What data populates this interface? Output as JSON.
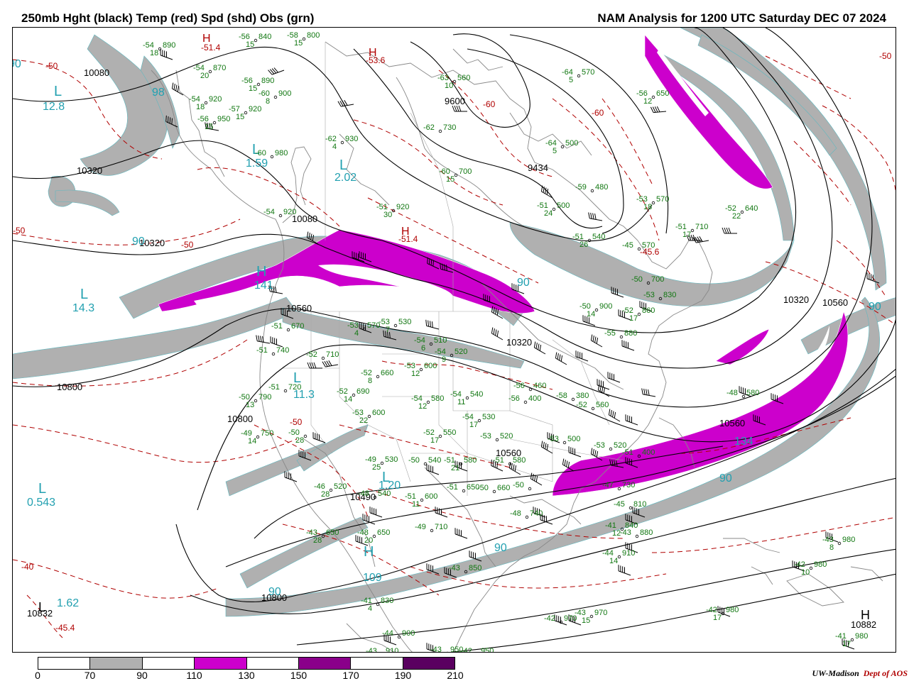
{
  "header": {
    "left_title": "250mb Hght (black) Temp (red) Spd (shd) Obs (grn)",
    "right_title": "NAM Analysis for 1200 UTC Saturday  DEC 07 2024"
  },
  "credit": {
    "org": "UW-Madison",
    "dept": "Dept of AOS"
  },
  "colors": {
    "height_contour": "#000000",
    "temp_contour": "#b00000",
    "obs": "#117711",
    "speed_label": "#22a0b0",
    "land": "#888888"
  },
  "colorbar": {
    "ticks": [
      "0",
      "70",
      "90",
      "110",
      "130",
      "150",
      "170",
      "190",
      "210"
    ],
    "segments": [
      "#ffffff",
      "#b0b0b0",
      "#ffffff",
      "#cc00cc",
      "#ffffff",
      "#8a008a",
      "#ffffff",
      "#5a0060"
    ]
  },
  "height_labels": [
    "10080",
    "10320",
    "10320",
    "10080",
    "10560",
    "10800",
    "10800",
    "10800",
    "10832",
    "10490",
    "10560",
    "10320",
    "10320",
    "10560",
    "10560",
    "10882",
    "9434",
    "9600"
  ],
  "temp_labels": [
    "-50",
    "-50",
    "-50",
    "-50",
    "-60",
    "-60",
    "-40",
    "-45.4",
    "-51.4",
    "-53.6",
    "-51.4",
    "-45.6",
    "-50"
  ],
  "pressure_centers": [
    {
      "letter": "H",
      "value": ""
    },
    {
      "letter": "H",
      "value": ""
    },
    {
      "letter": "H",
      "value": ""
    },
    {
      "letter": "L",
      "value": ""
    },
    {
      "letter": "L",
      "value": ""
    },
    {
      "letter": "L",
      "value": ""
    },
    {
      "letter": "L",
      "value": ""
    },
    {
      "letter": "L",
      "value": ""
    },
    {
      "letter": "L",
      "value": ""
    },
    {
      "letter": "H",
      "value": ""
    },
    {
      "letter": "L",
      "value": ""
    },
    {
      "letter": "L",
      "value": ""
    },
    {
      "letter": "H",
      "value": ""
    },
    {
      "letter": "H",
      "value": ""
    }
  ],
  "speed_labels": [
    "12.8",
    "141",
    "14.3",
    "1.59",
    "2.02",
    "0.543",
    "1.62",
    "1.20",
    "109",
    "11.3",
    "134",
    "98",
    "90",
    "90",
    "90",
    "90",
    "90",
    "90",
    "90",
    "90"
  ],
  "observations": [
    {
      "t": "-54",
      "h": "890",
      "d": "18"
    },
    {
      "t": "-54",
      "h": "870",
      "d": "20"
    },
    {
      "t": "-54",
      "h": "920",
      "d": "18"
    },
    {
      "t": "-56",
      "h": "950",
      "d": "15"
    },
    {
      "t": "-57",
      "h": "920",
      "d": "15"
    },
    {
      "t": "-56",
      "h": "890",
      "d": "15"
    },
    {
      "t": "-60",
      "h": "900",
      "d": "8"
    },
    {
      "t": "-58",
      "h": "800",
      "d": "15"
    },
    {
      "t": "-56",
      "h": "840",
      "d": "15"
    },
    {
      "t": "-63",
      "h": "560",
      "d": "10"
    },
    {
      "t": "-64",
      "h": "570",
      "d": "5"
    },
    {
      "t": "-56",
      "h": "650",
      "d": "12"
    },
    {
      "t": "-62",
      "h": "730",
      "d": ""
    },
    {
      "t": "-62",
      "h": "930",
      "d": "4"
    },
    {
      "t": "-60",
      "h": "980",
      "d": ""
    },
    {
      "t": "-60",
      "h": "700",
      "d": "15"
    },
    {
      "t": "-64",
      "h": "500",
      "d": "5"
    },
    {
      "t": "-59",
      "h": "480",
      "d": ""
    },
    {
      "t": "-51",
      "h": "500",
      "d": "24"
    },
    {
      "t": "-53",
      "h": "570",
      "d": "18"
    },
    {
      "t": "-51",
      "h": "540",
      "d": "26"
    },
    {
      "t": "-45",
      "h": "570",
      "d": ""
    },
    {
      "t": "-52",
      "h": "640",
      "d": "22"
    },
    {
      "t": "-51",
      "h": "710",
      "d": "17"
    },
    {
      "t": "-50",
      "h": "700",
      "d": ""
    },
    {
      "t": "-51",
      "h": "920",
      "d": "30"
    },
    {
      "t": "-54",
      "h": "920",
      "d": ""
    },
    {
      "t": "-51",
      "h": "740",
      "d": ""
    },
    {
      "t": "-52",
      "h": "710",
      "d": ""
    },
    {
      "t": "-51",
      "h": "670",
      "d": ""
    },
    {
      "t": "-53",
      "h": "570",
      "d": "4"
    },
    {
      "t": "-53",
      "h": "530",
      "d": "7"
    },
    {
      "t": "-54",
      "h": "510",
      "d": "6"
    },
    {
      "t": "-54",
      "h": "520",
      "d": "9"
    },
    {
      "t": "-52",
      "h": "660",
      "d": "8"
    },
    {
      "t": "-53",
      "h": "600",
      "d": "12"
    },
    {
      "t": "-51",
      "h": "720",
      "d": ""
    },
    {
      "t": "-52",
      "h": "690",
      "d": "14"
    },
    {
      "t": "-50",
      "h": "790",
      "d": "13"
    },
    {
      "t": "-49",
      "h": "750",
      "d": "14"
    },
    {
      "t": "-50",
      "h": "",
      "d": "28"
    },
    {
      "t": "-53",
      "h": "600",
      "d": "22"
    },
    {
      "t": "-54",
      "h": "580",
      "d": "12"
    },
    {
      "t": "-54",
      "h": "540",
      "d": "11"
    },
    {
      "t": "-54",
      "h": "530",
      "d": "17"
    },
    {
      "t": "-52",
      "h": "550",
      "d": "17"
    },
    {
      "t": "-53",
      "h": "520",
      "d": ""
    },
    {
      "t": "-56",
      "h": "460",
      "d": ""
    },
    {
      "t": "-56",
      "h": "400",
      "d": ""
    },
    {
      "t": "-58",
      "h": "380",
      "d": ""
    },
    {
      "t": "-49",
      "h": "530",
      "d": "25"
    },
    {
      "t": "-50",
      "h": "540",
      "d": ""
    },
    {
      "t": "-51",
      "h": "580",
      "d": "21"
    },
    {
      "t": "-51",
      "h": "580",
      "d": ""
    },
    {
      "t": "-46",
      "h": "520",
      "d": "28"
    },
    {
      "t": "-48",
      "h": "540",
      "d": ""
    },
    {
      "t": "-51",
      "h": "600",
      "d": "11"
    },
    {
      "t": "-51",
      "h": "650",
      "d": ""
    },
    {
      "t": "-50",
      "h": "660",
      "d": ""
    },
    {
      "t": "-50",
      "h": "",
      "d": ""
    },
    {
      "t": "-48",
      "h": "650",
      "d": "20"
    },
    {
      "t": "-49",
      "h": "710",
      "d": ""
    },
    {
      "t": "-48",
      "h": "740",
      "d": ""
    },
    {
      "t": "-43",
      "h": "650",
      "d": "28"
    },
    {
      "t": "-43",
      "h": "850",
      "d": ""
    },
    {
      "t": "-47",
      "h": "730",
      "d": ""
    },
    {
      "t": "-45",
      "h": "810",
      "d": ""
    },
    {
      "t": "-41",
      "h": "840",
      "d": "12"
    },
    {
      "t": "-43",
      "h": "880",
      "d": ""
    },
    {
      "t": "-44",
      "h": "910",
      "d": "14"
    },
    {
      "t": "-43",
      "h": "980",
      "d": "8"
    },
    {
      "t": "-42",
      "h": "980",
      "d": "10"
    },
    {
      "t": "-42",
      "h": "980",
      "d": "17"
    },
    {
      "t": "-41",
      "h": "980",
      "d": "17"
    },
    {
      "t": "-42",
      "h": "970",
      "d": ""
    },
    {
      "t": "-43",
      "h": "970",
      "d": "15"
    },
    {
      "t": "-44",
      "h": "900",
      "d": ""
    },
    {
      "t": "-43",
      "h": "910",
      "d": ""
    },
    {
      "t": "-43",
      "h": "950",
      "d": ""
    },
    {
      "t": "-42",
      "h": "950",
      "d": ""
    },
    {
      "t": "-41",
      "h": "830",
      "d": "4"
    },
    {
      "t": "-48",
      "h": "580",
      "d": ""
    },
    {
      "t": "-51",
      "h": "400",
      "d": ""
    },
    {
      "t": "-53",
      "h": "500",
      "d": ""
    },
    {
      "t": "-53",
      "h": "520",
      "d": ""
    },
    {
      "t": "-52",
      "h": "560",
      "d": ""
    },
    {
      "t": "-55",
      "h": "880",
      "d": ""
    },
    {
      "t": "-52",
      "h": "860",
      "d": "17"
    },
    {
      "t": "-50",
      "h": "900",
      "d": "14"
    },
    {
      "t": "-53",
      "h": "830",
      "d": ""
    }
  ]
}
